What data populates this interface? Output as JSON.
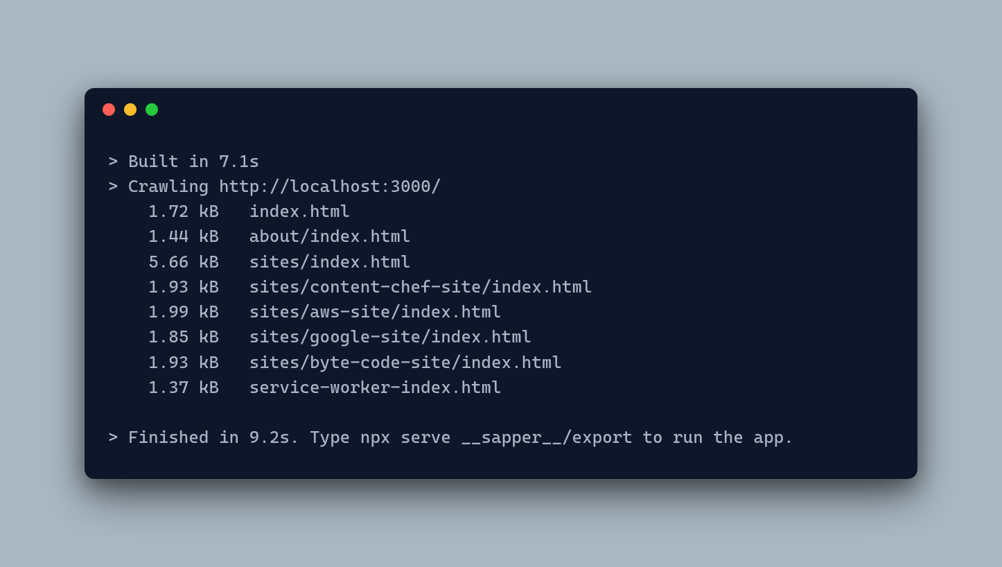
{
  "terminal": {
    "built_line": "> Built in 7.1s",
    "crawling_line": "> Crawling http://localhost:3000/",
    "files": [
      {
        "size": "1.72 kB",
        "path": "index.html"
      },
      {
        "size": "1.44 kB",
        "path": "about/index.html"
      },
      {
        "size": "5.66 kB",
        "path": "sites/index.html"
      },
      {
        "size": "1.93 kB",
        "path": "sites/content-chef-site/index.html"
      },
      {
        "size": "1.99 kB",
        "path": "sites/aws-site/index.html"
      },
      {
        "size": "1.85 kB",
        "path": "sites/google-site/index.html"
      },
      {
        "size": "1.93 kB",
        "path": "sites/byte-code-site/index.html"
      },
      {
        "size": "1.37 kB",
        "path": "service-worker-index.html"
      }
    ],
    "finished_line": "> Finished in 9.2s. Type npx serve __sapper__/export to run the app."
  }
}
